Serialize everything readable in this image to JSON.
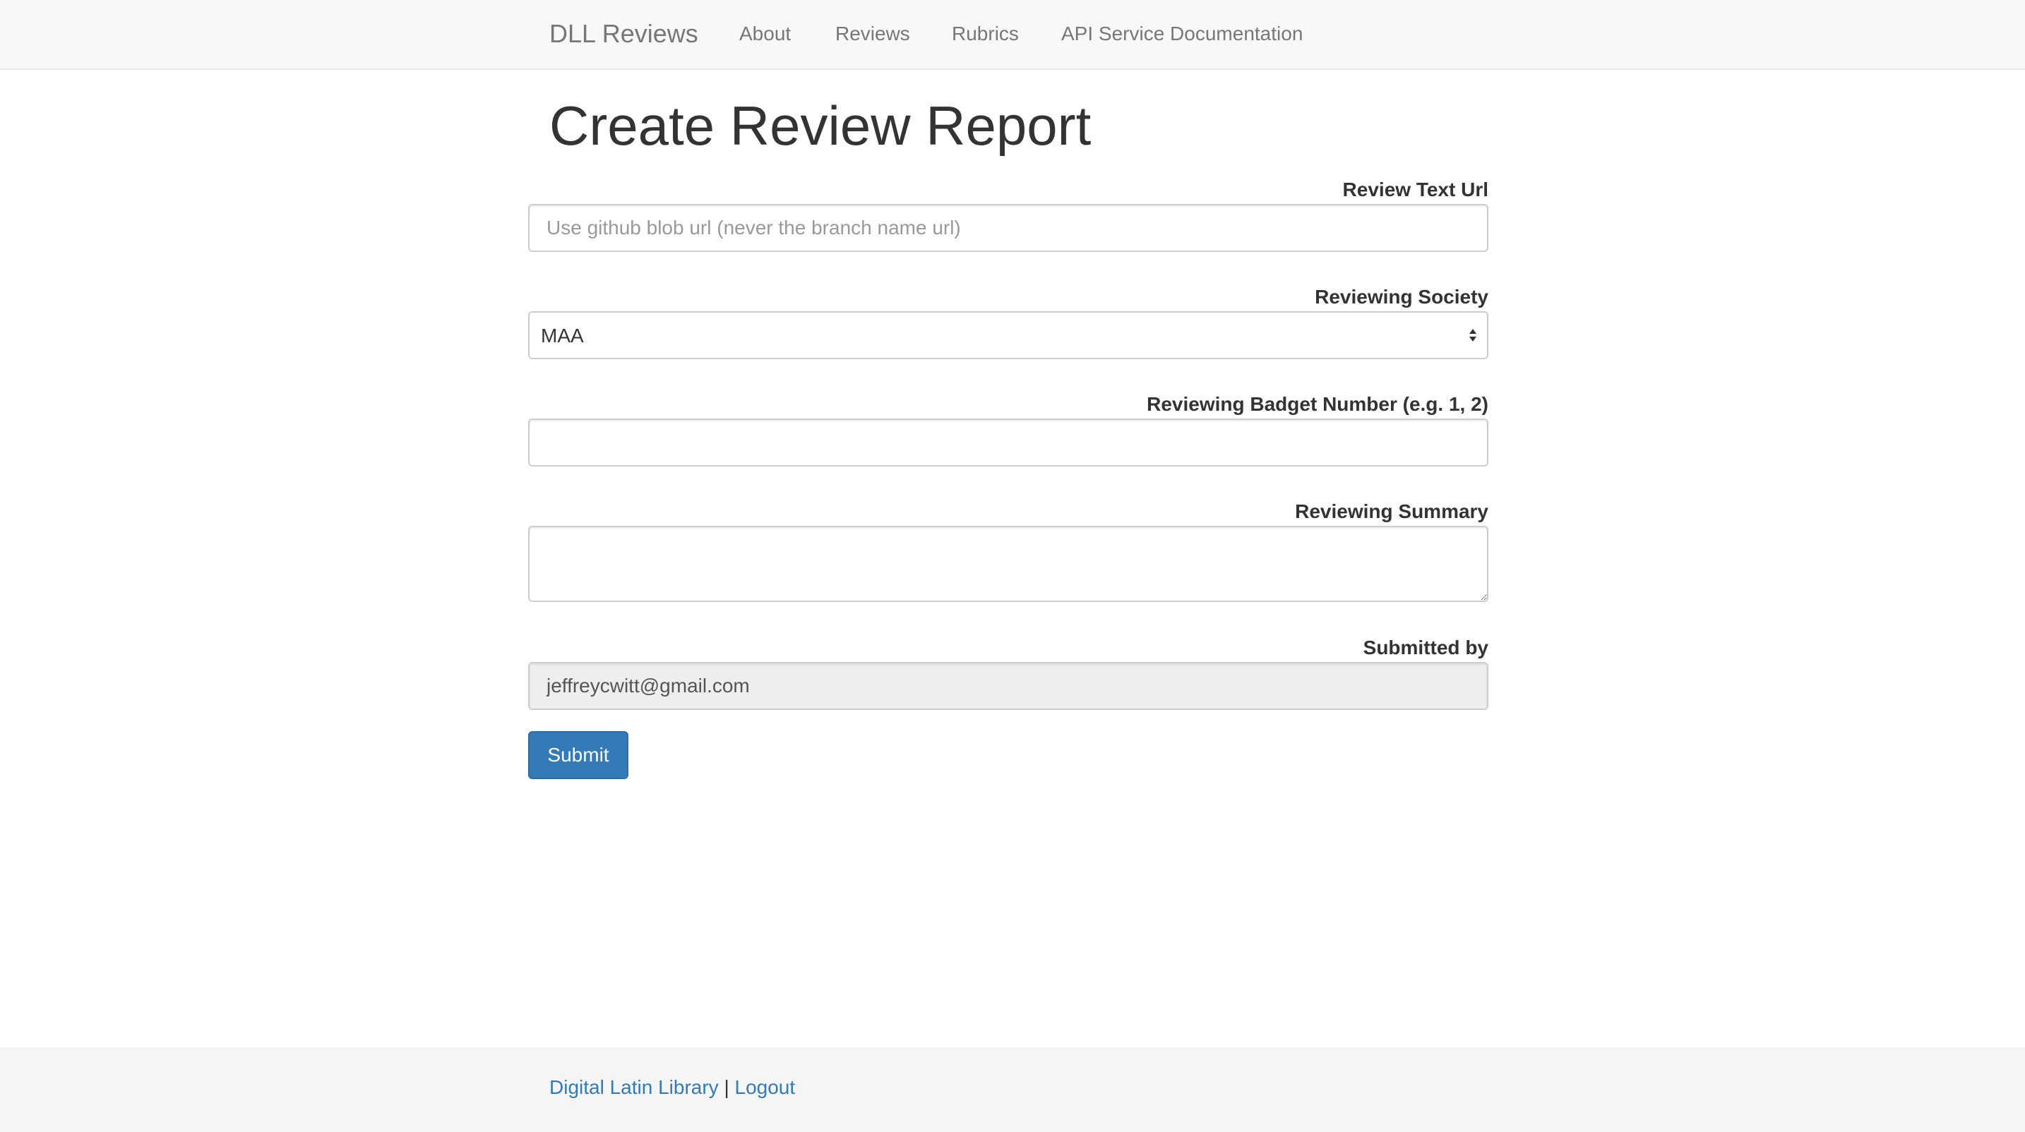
{
  "navbar": {
    "brand": "DLL Reviews",
    "links": [
      {
        "label": "About"
      },
      {
        "label": "Reviews"
      },
      {
        "label": "Rubrics"
      },
      {
        "label": "API Service Documentation"
      }
    ]
  },
  "page": {
    "title": "Create Review Report"
  },
  "form": {
    "review_text_url": {
      "label": "Review Text Url",
      "value": "",
      "placeholder": "Use github blob url (never the branch name url)"
    },
    "reviewing_society": {
      "label": "Reviewing Society",
      "selected": "MAA"
    },
    "badge_number": {
      "label": "Reviewing Badget Number (e.g. 1, 2)",
      "value": ""
    },
    "summary": {
      "label": "Reviewing Summary",
      "value": ""
    },
    "submitted_by": {
      "label": "Submitted by",
      "value": "jeffreycwitt@gmail.com"
    },
    "submit_label": "Submit"
  },
  "footer": {
    "library_link": "Digital Latin Library",
    "separator": "|",
    "logout_link": "Logout"
  },
  "colors": {
    "navbar_bg": "#f8f8f8",
    "footer_bg": "#f5f5f5",
    "primary": "#337ab7",
    "readonly_bg": "#eeeeee"
  },
  "icons": {
    "select_arrows": "select-updown-arrows-icon"
  }
}
